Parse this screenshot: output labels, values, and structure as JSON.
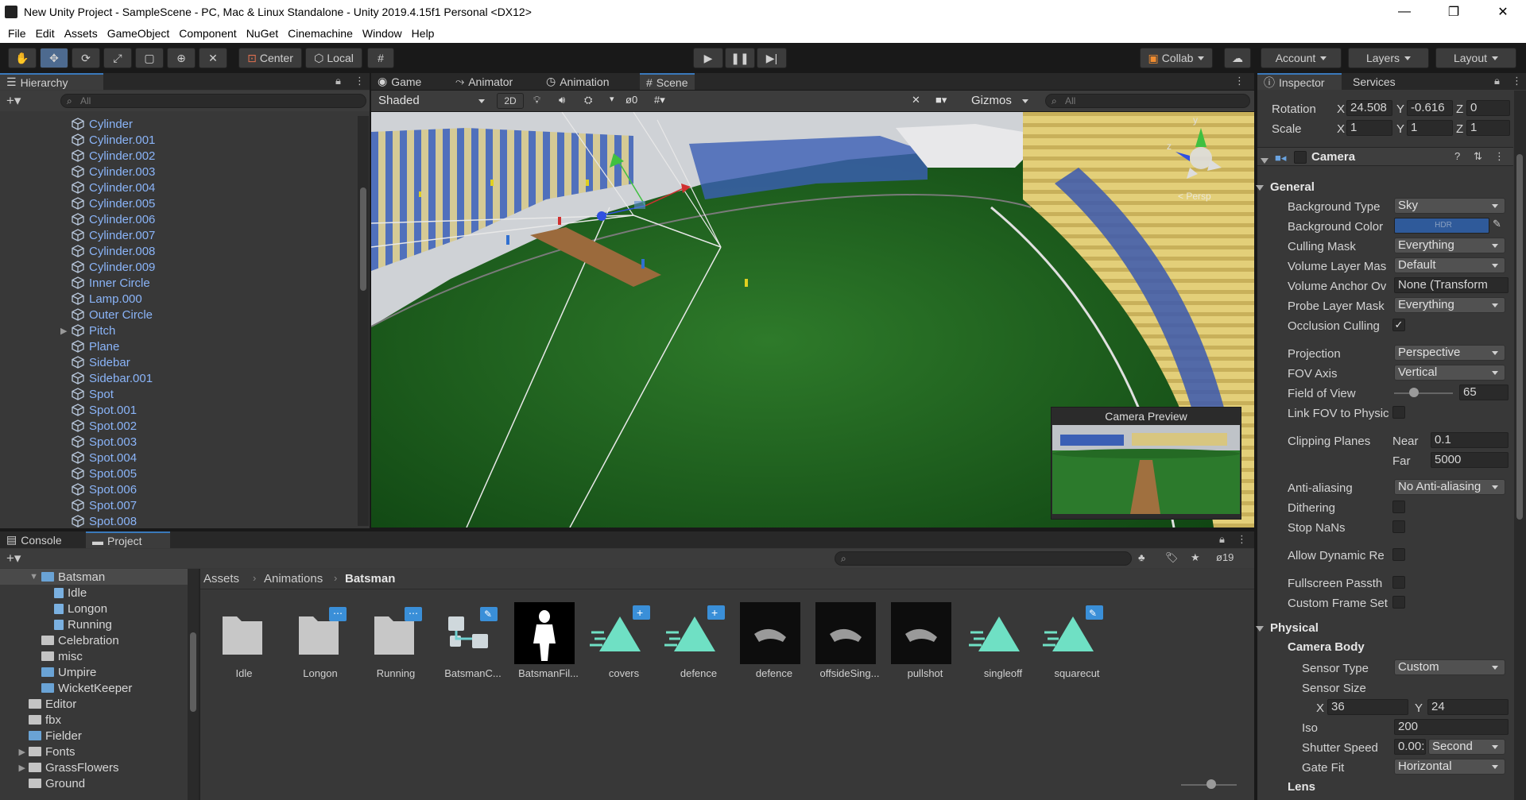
{
  "window": {
    "title": "New Unity Project - SampleScene - PC, Mac & Linux Standalone - Unity 2019.4.15f1 Personal <DX12>",
    "minimize": "—",
    "maximize": "❐",
    "close": "✕"
  },
  "menu": [
    "File",
    "Edit",
    "Assets",
    "GameObject",
    "Component",
    "NuGet",
    "Cinemachine",
    "Window",
    "Help"
  ],
  "toolbar": {
    "pivot_label": "Center",
    "space_label": "Local",
    "collab_label": "Collab",
    "account_label": "Account",
    "layers_label": "Layers",
    "layout_label": "Layout"
  },
  "hierarchy": {
    "tab_label": "Hierarchy",
    "search_placeholder": "All",
    "items": [
      "Cylinder",
      "Cylinder.001",
      "Cylinder.002",
      "Cylinder.003",
      "Cylinder.004",
      "Cylinder.005",
      "Cylinder.006",
      "Cylinder.007",
      "Cylinder.008",
      "Cylinder.009",
      "Inner Circle",
      "Lamp.000",
      "Outer Circle",
      "Pitch",
      "Plane",
      "Sidebar",
      "Sidebar.001",
      "Spot",
      "Spot.001",
      "Spot.002",
      "Spot.003",
      "Spot.004",
      "Spot.005",
      "Spot.006",
      "Spot.007",
      "Spot.008"
    ]
  },
  "scene_view": {
    "tabs": [
      "Game",
      "Animator",
      "Animation",
      "Scene"
    ],
    "shading_mode": "Shaded",
    "mode_2d": "2D",
    "hidden_count": "0",
    "gizmos_label": "Gizmos",
    "search_placeholder": "All",
    "persp_label": "< Persp",
    "gizmo_axis_y": "y",
    "gizmo_axis_z": "z",
    "camera_preview_title": "Camera Preview"
  },
  "project": {
    "tabs": [
      "Console",
      "Project"
    ],
    "hidden_count": "19",
    "breadcrumb": [
      "Assets",
      "Animations",
      "Batsman"
    ],
    "tree": [
      {
        "label": "Batsman",
        "indent": 2,
        "type": "folder-blue",
        "expanded": true,
        "selected": true
      },
      {
        "label": "Idle",
        "indent": 3,
        "type": "anim"
      },
      {
        "label": "Longon",
        "indent": 3,
        "type": "anim"
      },
      {
        "label": "Running",
        "indent": 3,
        "type": "anim"
      },
      {
        "label": "Celebration",
        "indent": 2,
        "type": "folder"
      },
      {
        "label": "misc",
        "indent": 2,
        "type": "folder"
      },
      {
        "label": "Umpire",
        "indent": 2,
        "type": "folder-blue"
      },
      {
        "label": "WicketKeeper",
        "indent": 2,
        "type": "folder-blue"
      },
      {
        "label": "Editor",
        "indent": 1,
        "type": "folder"
      },
      {
        "label": "fbx",
        "indent": 1,
        "type": "folder"
      },
      {
        "label": "Fielder",
        "indent": 1,
        "type": "folder-blue"
      },
      {
        "label": "Fonts",
        "indent": 1,
        "type": "folder",
        "collapsed": true
      },
      {
        "label": "GrassFlowers",
        "indent": 1,
        "type": "folder",
        "collapsed": true
      },
      {
        "label": "Ground",
        "indent": 1,
        "type": "folder"
      }
    ],
    "assets": [
      {
        "label": "Idle",
        "kind": "folder"
      },
      {
        "label": "Longon",
        "kind": "folder-badge"
      },
      {
        "label": "Running",
        "kind": "folder-badge"
      },
      {
        "label": "BatsmanC...",
        "kind": "controller"
      },
      {
        "label": "BatsmanFil...",
        "kind": "model-white"
      },
      {
        "label": "covers",
        "kind": "clip-plus"
      },
      {
        "label": "defence",
        "kind": "clip-plus"
      },
      {
        "label": "defence",
        "kind": "model-dark"
      },
      {
        "label": "offsideSing...",
        "kind": "model-dark"
      },
      {
        "label": "pullshot",
        "kind": "model-dark"
      },
      {
        "label": "singleoff",
        "kind": "clip"
      },
      {
        "label": "squarecut",
        "kind": "clip-edit"
      }
    ]
  },
  "inspector": {
    "tabs": [
      "Inspector",
      "Services"
    ],
    "rotation": {
      "label": "Rotation",
      "x": "24.508",
      "y": "-0.616",
      "z": "0"
    },
    "scale": {
      "label": "Scale",
      "x": "1",
      "y": "1",
      "z": "1"
    },
    "component_title": "Camera",
    "general_header": "General",
    "fields": [
      {
        "label": "Background Type",
        "value": "Sky",
        "kind": "dropdown"
      },
      {
        "label": "Background Color",
        "value": "HDR",
        "kind": "color",
        "color": "#2f5a9a"
      },
      {
        "label": "Culling Mask",
        "value": "Everything",
        "kind": "dropdown"
      },
      {
        "label": "Volume Layer Mas",
        "value": "Default",
        "kind": "dropdown"
      },
      {
        "label": "Volume Anchor Ov",
        "value": "None (Transform",
        "kind": "object"
      },
      {
        "label": "Probe Layer Mask",
        "value": "Everything",
        "kind": "dropdown"
      },
      {
        "label": "Occlusion Culling",
        "value": "✓",
        "kind": "check"
      }
    ],
    "projection": {
      "label": "Projection",
      "value": "Perspective"
    },
    "fov_axis": {
      "label": "FOV Axis",
      "value": "Vertical"
    },
    "fov": {
      "label": "Field of View",
      "value": "65",
      "slider_fraction": 0.18
    },
    "link_fov": {
      "label": "Link FOV to Physic"
    },
    "clipping": {
      "label": "Clipping Planes",
      "near_label": "Near",
      "near": "0.1",
      "far_label": "Far",
      "far": "5000"
    },
    "anti_aliasing": {
      "label": "Anti-aliasing",
      "value": "No Anti-aliasing"
    },
    "dithering": {
      "label": "Dithering"
    },
    "stop_nans": {
      "label": "Stop NaNs"
    },
    "allow_dynamic": {
      "label": "Allow Dynamic Re"
    },
    "fullscreen_pass": {
      "label": "Fullscreen Passth"
    },
    "custom_frame": {
      "label": "Custom Frame Set"
    },
    "physical_header": "Physical",
    "camera_body_header": "Camera Body",
    "sensor_type": {
      "label": "Sensor Type",
      "value": "Custom"
    },
    "sensor_size": {
      "label": "Sensor Size",
      "x_label": "X",
      "x": "36",
      "y_label": "Y",
      "y": "24"
    },
    "iso": {
      "label": "Iso",
      "value": "200"
    },
    "shutter": {
      "label": "Shutter Speed",
      "value": "0.00:",
      "unit": "Second"
    },
    "gate_fit": {
      "label": "Gate Fit",
      "value": "Horizontal"
    },
    "lens_header": "Lens"
  }
}
